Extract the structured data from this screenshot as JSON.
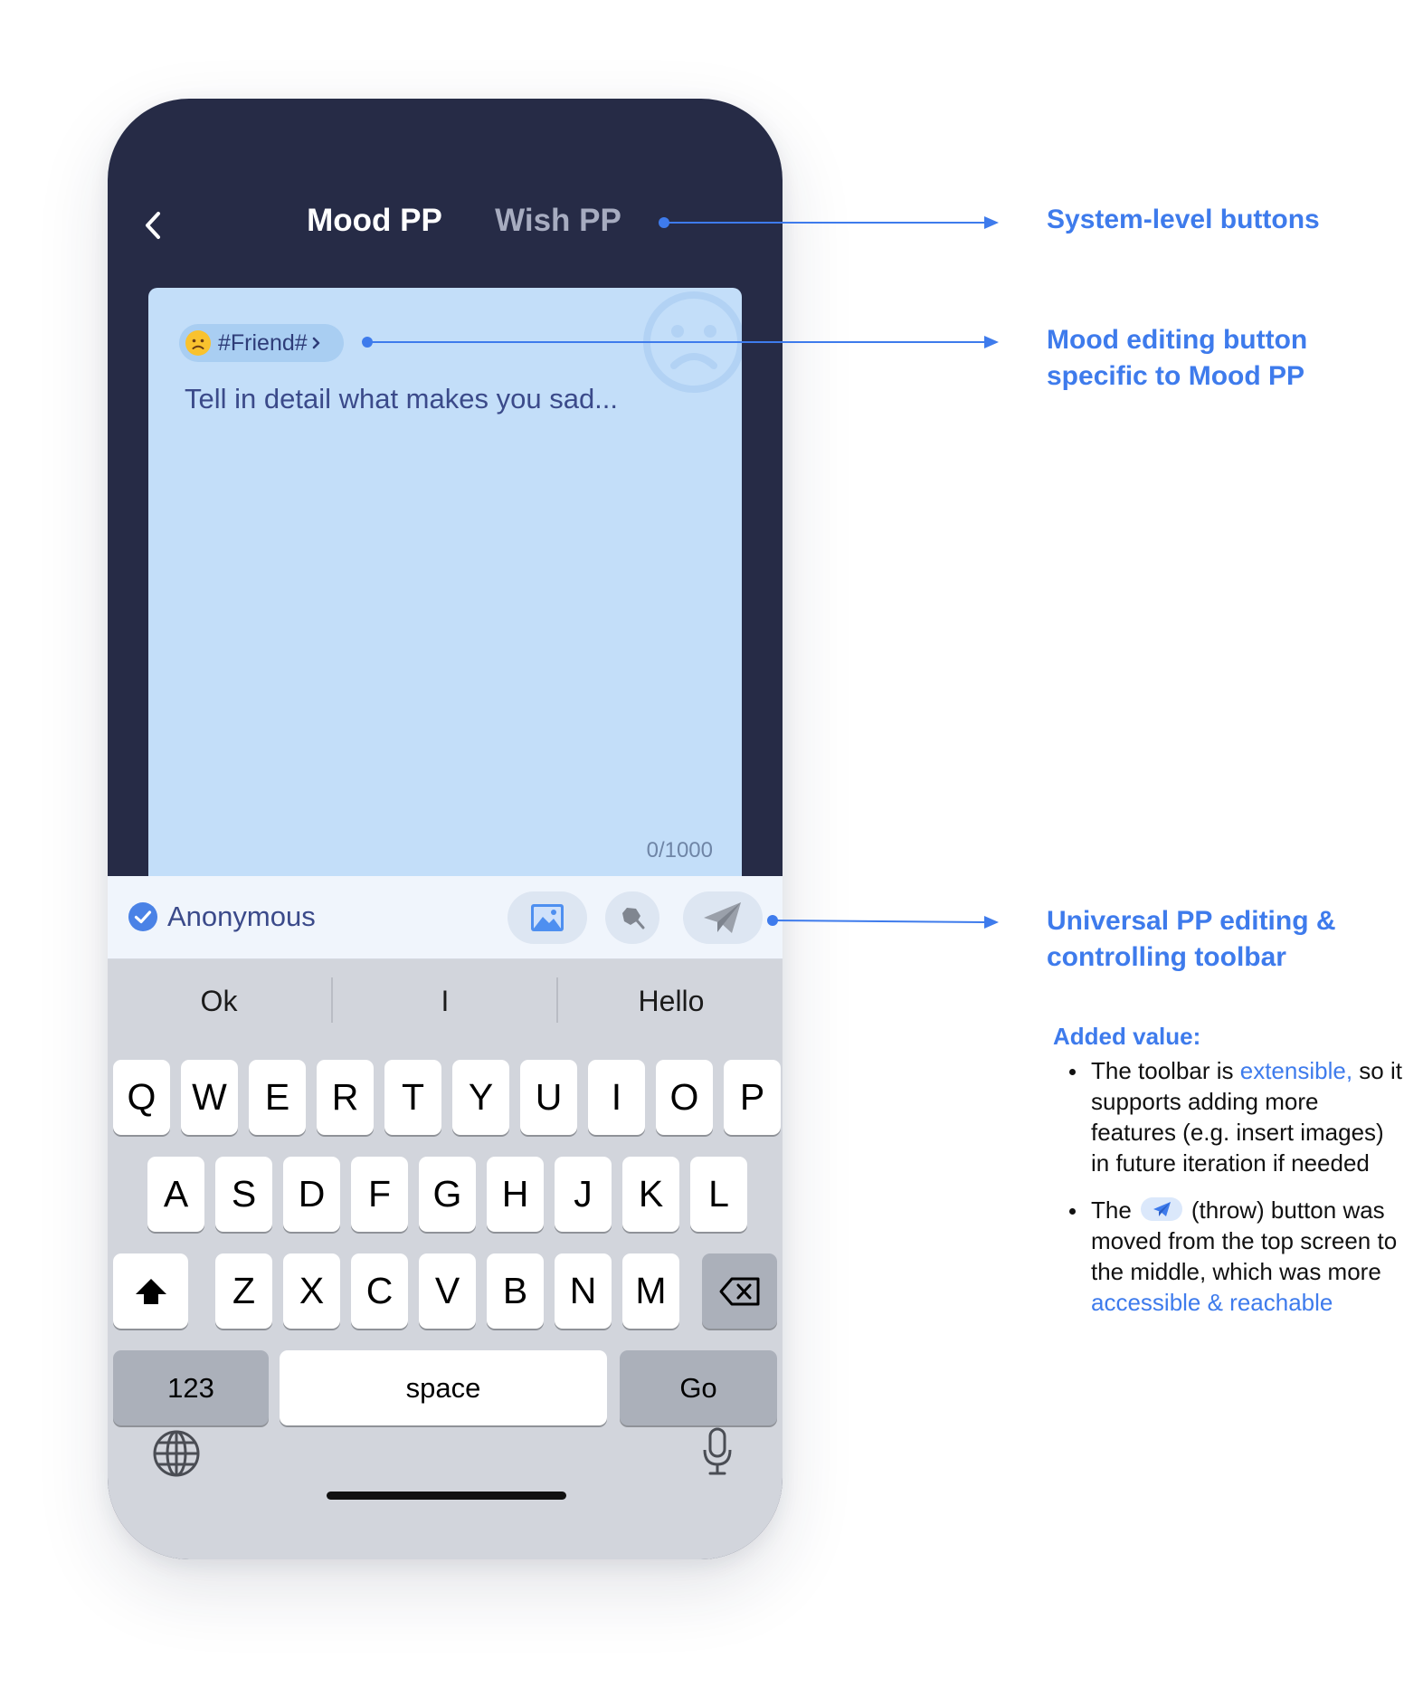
{
  "header": {
    "back_icon": "chevron-left-icon",
    "tabs": [
      {
        "label": "Mood PP",
        "active": true
      },
      {
        "label": "Wish PP",
        "active": false
      }
    ]
  },
  "card": {
    "mood_tag": {
      "emoji_icon": "sad-face-icon",
      "label": "#Friend#"
    },
    "placeholder": "Tell in detail what makes you sad...",
    "counter": "0/1000",
    "background_color": "#c3def9"
  },
  "toolbar": {
    "anonymous": {
      "label": "Anonymous",
      "checked": true
    },
    "buttons": [
      {
        "icon": "image-icon"
      },
      {
        "icon": "sticker-icon"
      },
      {
        "icon": "paper-plane-icon"
      }
    ]
  },
  "keyboard": {
    "suggestions": [
      "Ok",
      "I",
      "Hello"
    ],
    "row1": [
      "Q",
      "W",
      "E",
      "R",
      "T",
      "Y",
      "U",
      "I",
      "O",
      "P"
    ],
    "row2": [
      "A",
      "S",
      "D",
      "F",
      "G",
      "H",
      "J",
      "K",
      "L"
    ],
    "row3": [
      "Z",
      "X",
      "C",
      "V",
      "B",
      "N",
      "M"
    ],
    "numbers_label": "123",
    "space_label": "space",
    "go_label": "Go",
    "shift_icon": "shift-icon",
    "delete_icon": "backspace-icon",
    "globe_icon": "globe-icon",
    "mic_icon": "microphone-icon"
  },
  "annotations": {
    "system": "System-level buttons",
    "mood_line1": "Mood editing button",
    "mood_line2": "specific to Mood PP",
    "toolbar_line1": "Universal PP editing &",
    "toolbar_line2": "controlling toolbar"
  },
  "added_value": {
    "title": "Added value:",
    "item1": {
      "pre": "The toolbar is ",
      "highlight": "extensible,",
      "post": "so it supports adding more features (e.g. insert images) in future iteration if needed"
    },
    "item2": {
      "pre": "The",
      "icon": "paper-plane-icon",
      "mid": "(throw) button was moved from the top screen to the middle, which was more",
      "highlight": "accessible & reachable"
    }
  },
  "colors": {
    "header_bg": "#262b46",
    "accent": "#3e7bec",
    "card_bg": "#c3def9",
    "keyboard_bg": "#d2d5dc"
  }
}
